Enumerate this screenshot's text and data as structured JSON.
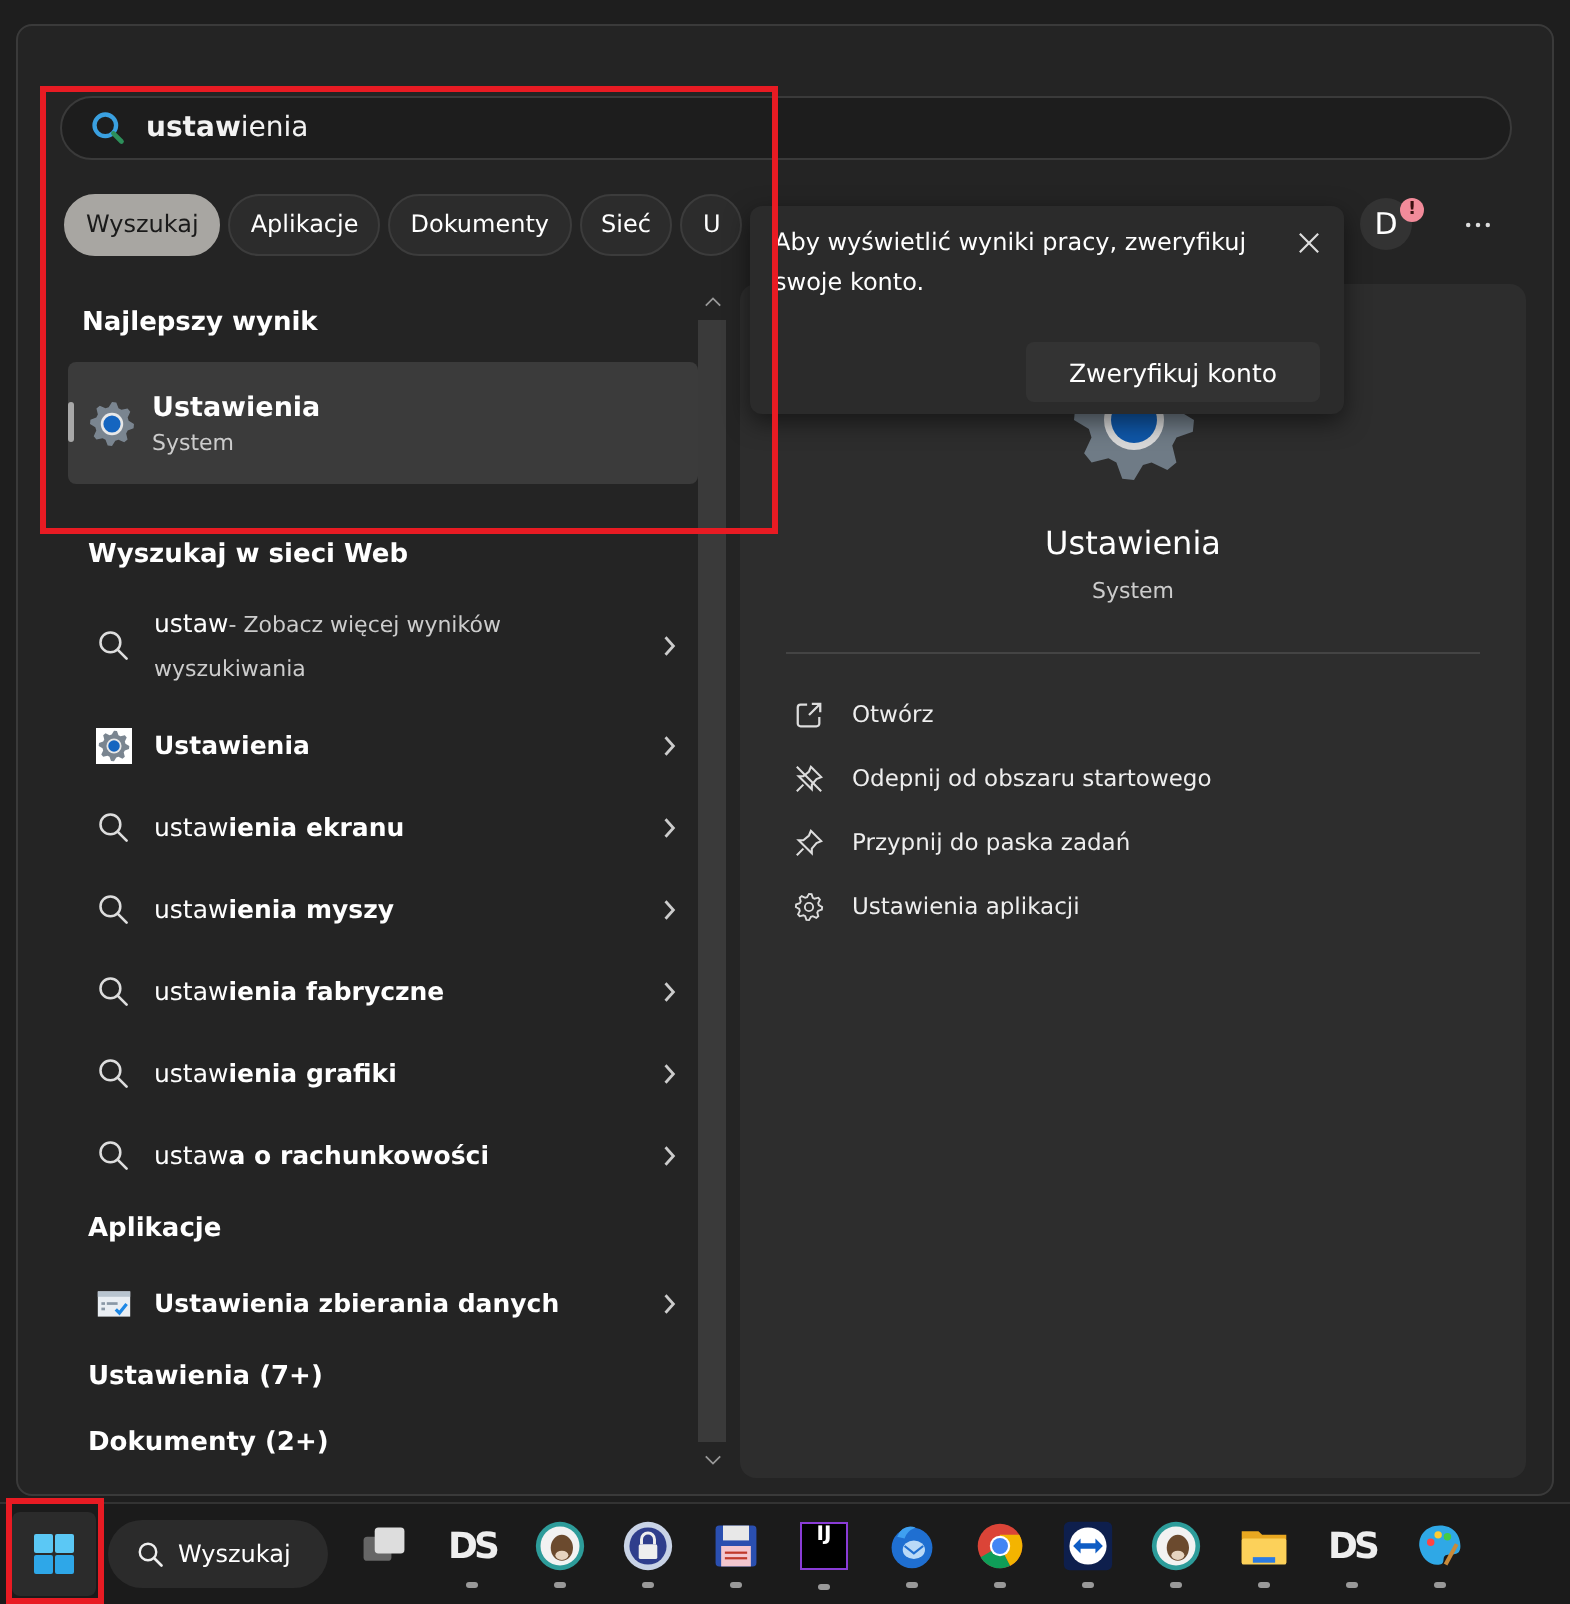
{
  "search": {
    "value": "**ustaw**ienia"
  },
  "filters": [
    {
      "label": "Wyszukaj",
      "selected": true
    },
    {
      "label": "Aplikacje",
      "selected": false
    },
    {
      "label": "Dokumenty",
      "selected": false
    },
    {
      "label": "Sieć",
      "selected": false
    },
    {
      "label": "U",
      "selected": false
    }
  ],
  "account": {
    "initial": "D",
    "badge": "!"
  },
  "notice": {
    "text": "Aby wyświetlić wyniki pracy, zweryfikuj swoje konto.",
    "button": "Zweryfikuj konto"
  },
  "results": [
    {
      "kind": "heading",
      "text": "Najlepszy wynik"
    },
    {
      "kind": "best",
      "text": "Ustawienia",
      "subtitle": "System",
      "selected": true
    },
    {
      "kind": "heading",
      "text": "Wyszukaj w sieci Web"
    },
    {
      "kind": "web",
      "text": "ustaw",
      "note": "- Zobacz więcej wyników wyszukiwania"
    },
    {
      "kind": "settings",
      "text": "Ustawienia"
    },
    {
      "kind": "web",
      "text": "ustaw**ienia ekranu**"
    },
    {
      "kind": "web",
      "text": "ustaw**ienia myszy**"
    },
    {
      "kind": "web",
      "text": "ustaw**ienia fabryczne**"
    },
    {
      "kind": "web",
      "text": "ustaw**ienia grafiki**"
    },
    {
      "kind": "web",
      "text": "ustaw**a o rachunkowości**"
    },
    {
      "kind": "heading",
      "text": "Aplikacje"
    },
    {
      "kind": "app",
      "text": "**Ustaw**ienia zbierania danych"
    },
    {
      "kind": "heading",
      "text": "Ustawienia (7+)"
    },
    {
      "kind": "heading",
      "text": "Dokumenty (2+)"
    }
  ],
  "preview": {
    "title": "Ustawienia",
    "subtitle": "System",
    "actions": [
      {
        "kind": "open",
        "label": "Otwórz"
      },
      {
        "kind": "unpin",
        "label": "Odepnij od obszaru startowego"
      },
      {
        "kind": "pin",
        "label": "Przypnij do paska zadań"
      },
      {
        "kind": "settings",
        "label": "Ustawienia aplikacji"
      }
    ]
  },
  "taskbar": {
    "search_label": "Wyszukaj",
    "apps": [
      {
        "kind": "taskview",
        "running": false
      },
      {
        "kind": "ds",
        "label": "DS",
        "running": true
      },
      {
        "kind": "beaver",
        "running": true
      },
      {
        "kind": "lock",
        "running": true
      },
      {
        "kind": "floppy",
        "running": true
      },
      {
        "kind": "ij",
        "label": "IJ",
        "running": true
      },
      {
        "kind": "mail",
        "running": true
      },
      {
        "kind": "chrome",
        "running": true
      },
      {
        "kind": "remote",
        "running": true
      },
      {
        "kind": "beaver",
        "running": true
      },
      {
        "kind": "folder",
        "running": true
      },
      {
        "kind": "ds",
        "label": "DS",
        "running": true
      },
      {
        "kind": "paint",
        "running": true
      }
    ]
  }
}
